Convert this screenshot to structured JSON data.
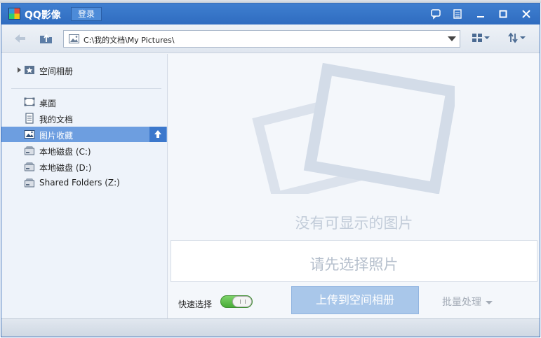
{
  "titlebar": {
    "title": "QQ影像",
    "login_label": "登录"
  },
  "toolbar": {
    "path": "C:\\我的文档\\My Pictures\\"
  },
  "sidebar": {
    "album": "空间相册",
    "items": [
      {
        "label": "桌面",
        "icon": "desktop-icon"
      },
      {
        "label": "我的文档",
        "icon": "document-icon"
      },
      {
        "label": "图片收藏",
        "icon": "picture-icon",
        "selected": true
      },
      {
        "label": "本地磁盘 (C:)",
        "icon": "disk-icon"
      },
      {
        "label": "本地磁盘 (D:)",
        "icon": "disk-icon"
      },
      {
        "label": "Shared Folders (Z:)",
        "icon": "disk-icon"
      }
    ]
  },
  "main": {
    "empty_text": "没有可显示的图片",
    "select_hint": "请先选择照片",
    "quick_select_label": "快速选择",
    "upload_label": "上传到空间相册",
    "batch_label": "批量处理"
  },
  "colors": {
    "titlebar": "#3a78c9",
    "selected_row": "#6d9ee0",
    "toggle_on": "#5dbb48",
    "upload_button": "#a9c7ea"
  }
}
